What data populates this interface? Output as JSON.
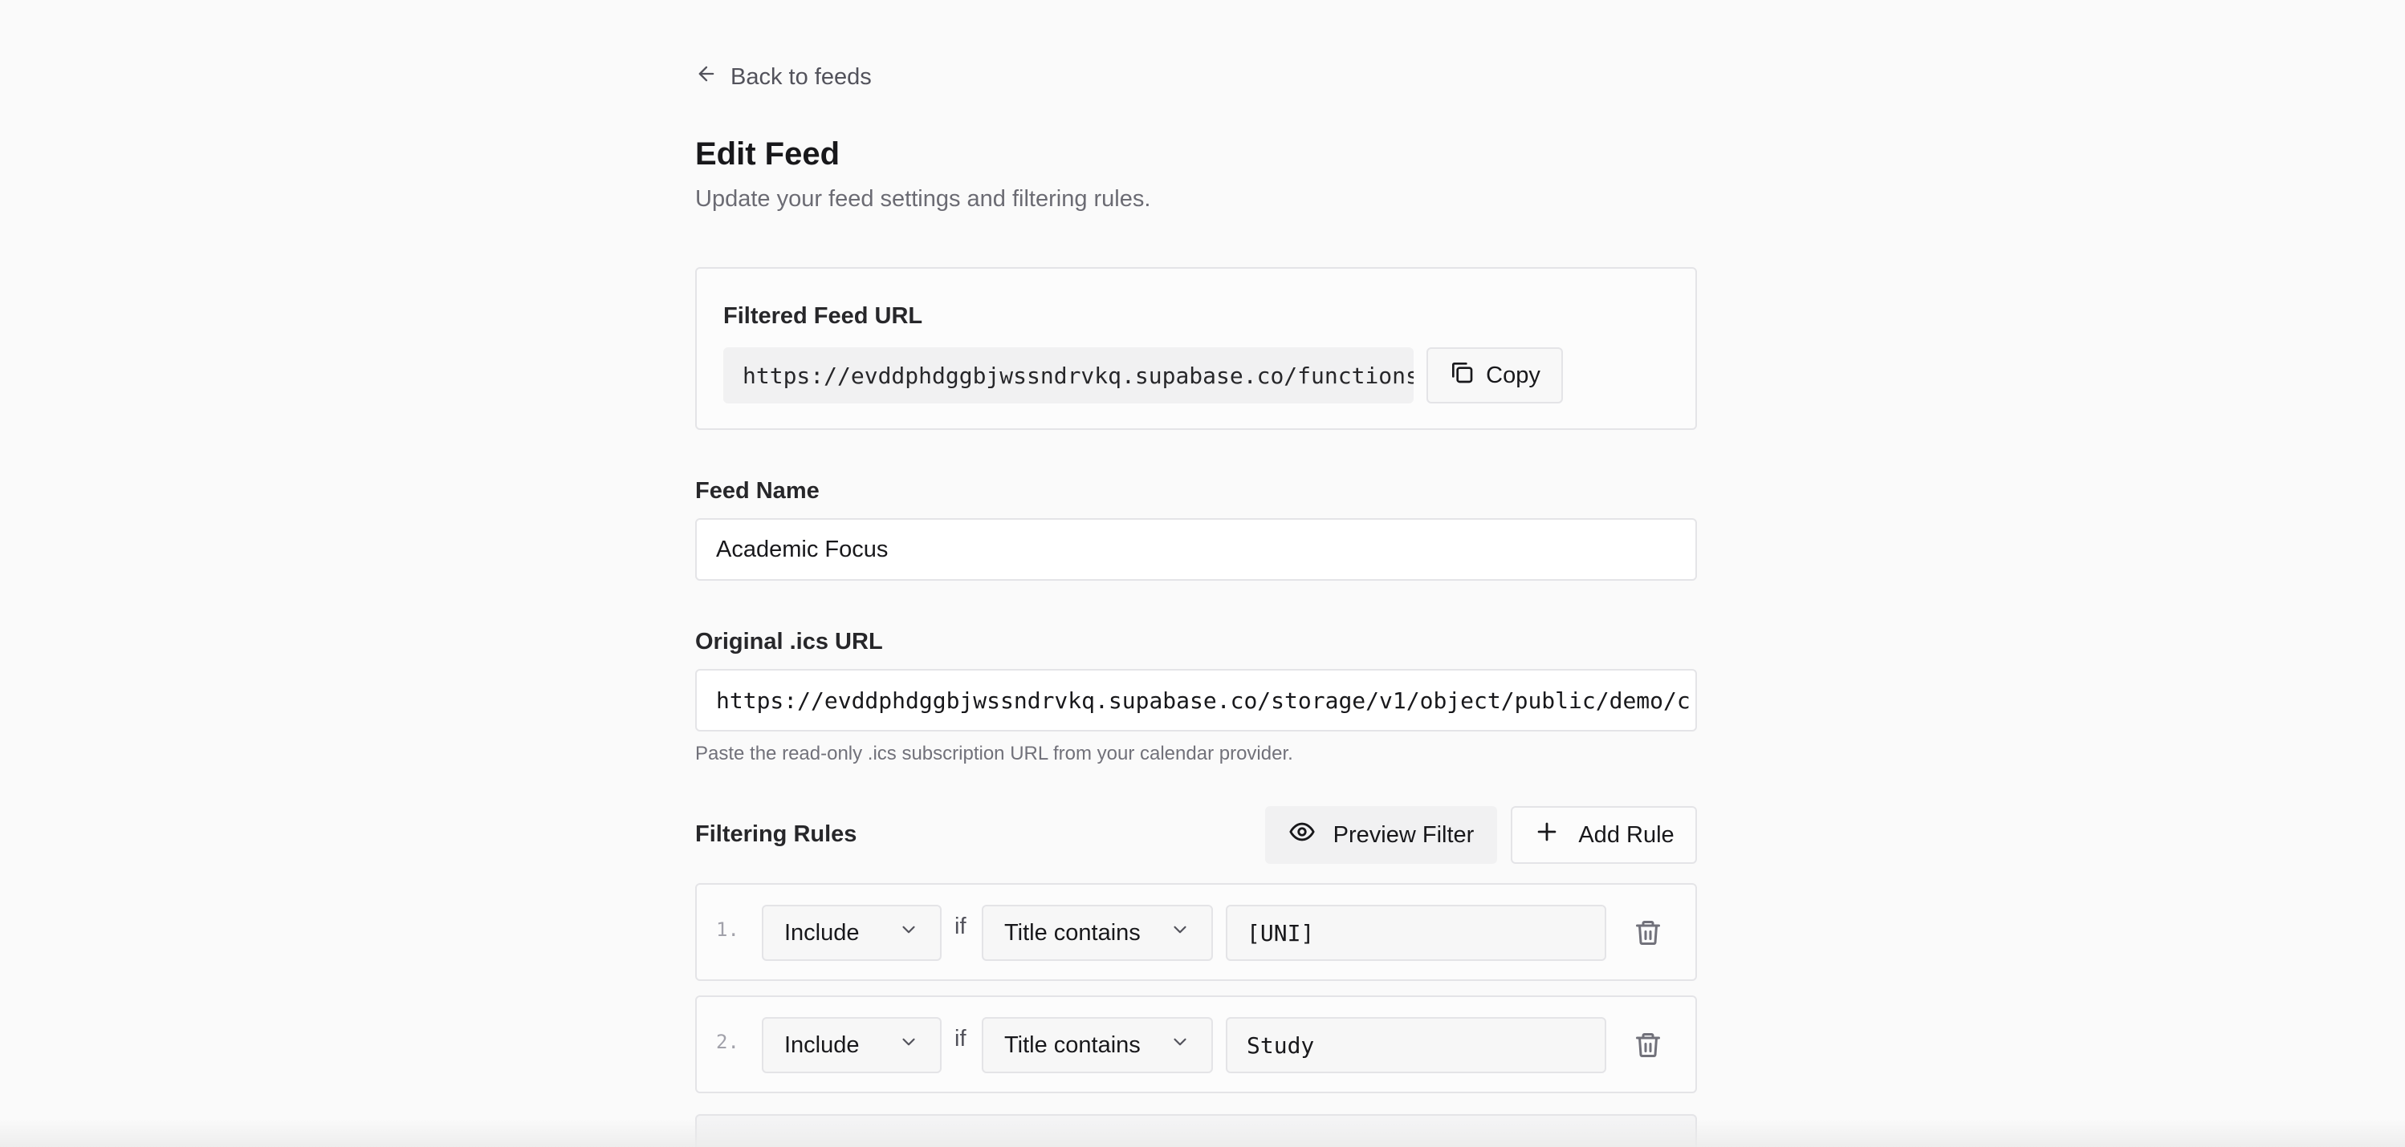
{
  "nav": {
    "back_label": "Back to feeds"
  },
  "header": {
    "title": "Edit Feed",
    "subtitle": "Update your feed settings and filtering rules."
  },
  "filtered_feed": {
    "label": "Filtered Feed URL",
    "url": "https://evddphdggbjwssndrvkq.supabase.co/functions/v1/s…",
    "copy_label": "Copy"
  },
  "feed_name": {
    "label": "Feed Name",
    "value": "Academic Focus"
  },
  "original_url": {
    "label": "Original .ics URL",
    "value": "https://evddphdggbjwssndrvkq.supabase.co/storage/v1/object/public/demo/c",
    "help": "Paste the read-only .ics subscription URL from your calendar provider."
  },
  "rules": {
    "title": "Filtering Rules",
    "preview_label": "Preview Filter",
    "add_label": "Add Rule",
    "connector": "if",
    "items": [
      {
        "num": "1.",
        "action": "Include",
        "condition": "Title contains",
        "value": "[UNI]"
      },
      {
        "num": "2.",
        "action": "Include",
        "condition": "Title contains",
        "value": "Study"
      }
    ]
  },
  "icons": {
    "back": "arrow-left-icon",
    "copy": "copy-icon",
    "preview": "eye-icon",
    "add": "plus-icon",
    "dropdown": "chevron-down-icon",
    "delete": "trash-icon"
  }
}
